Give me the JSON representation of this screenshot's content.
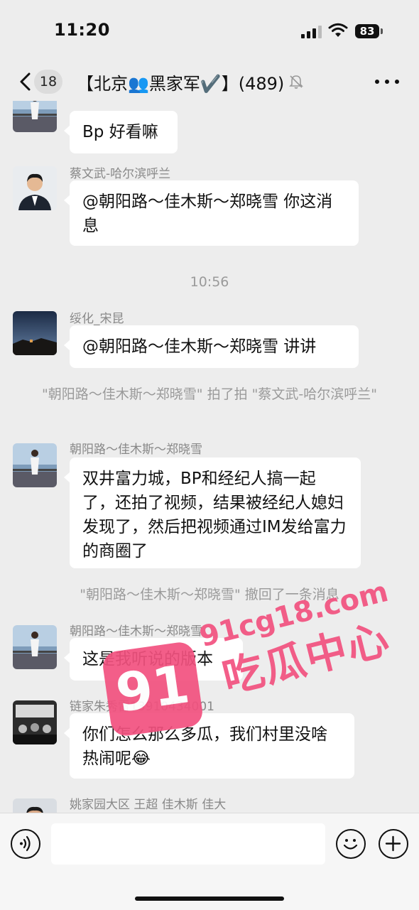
{
  "status_bar": {
    "time": "11:20",
    "battery": "83"
  },
  "header": {
    "unread_badge": "18",
    "title": "【北京👥黑家军✔️】(489)",
    "icons": [
      "back-chevron-icon",
      "mute-bell-icon",
      "more-dots-icon"
    ]
  },
  "messages": [
    {
      "sender": "",
      "text": "Bp 好看嘛",
      "avatar": "woman-seaside"
    },
    {
      "sender": "蔡文武-哈尔滨呼兰",
      "text": "@朝阳路～佳木斯～郑晓雪 你这消息",
      "avatar": "man-suit"
    },
    {
      "time": "10:56"
    },
    {
      "sender": "绥化_宋昆",
      "text": "@朝阳路～佳木斯～郑晓雪 讲讲",
      "avatar": "night-landscape"
    },
    {
      "system": "\"朝阳路～佳木斯～郑晓雪\" 拍了拍 \"蔡文武-哈尔滨呼兰\""
    },
    {
      "sender": "朝阳路～佳木斯～郑晓雪",
      "text": "双井富力城，BP和经纪人搞一起了，还拍了视频，结果被经纪人媳妇发现了，然后把视频通过IM发给富力的商圈了",
      "avatar": "woman-seaside"
    },
    {
      "system": "\"朝阳路～佳木斯～郑晓雪\" 撤回了一条消息"
    },
    {
      "sender": "朝阳路～佳木斯～郑晓雪",
      "text": "这是我听说的版本",
      "avatar": "woman-seaside"
    },
    {
      "sender": "链家朱秀雷13910434001",
      "text": "你们怎么那么多瓜，我们村里没啥热闹呢😂",
      "avatar": "meeting-room"
    },
    {
      "sender": "姚家园大区 王超 佳木斯 佳大",
      "text": "",
      "avatar": "man-portrait"
    }
  ],
  "watermark": {
    "logo": "91",
    "url": "91cg18.com",
    "text": "吃瓜中心"
  },
  "input_bar": {
    "placeholder": "",
    "icons": [
      "voice-icon",
      "emoji-icon",
      "plus-icon"
    ]
  },
  "colors": {
    "background": "#ededed",
    "bubble": "#ffffff",
    "watermark": "#f2517f"
  }
}
